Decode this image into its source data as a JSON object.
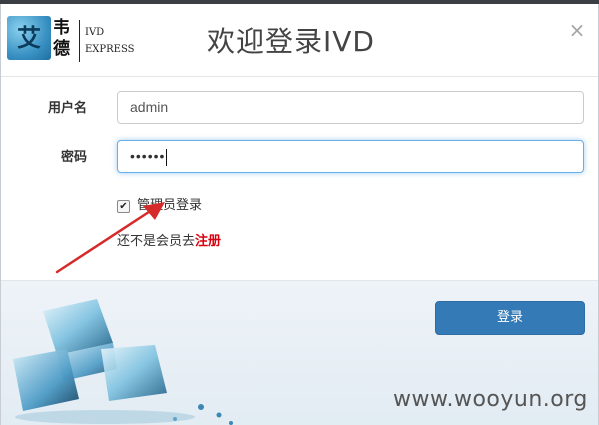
{
  "logo": {
    "badge_char": "艾",
    "chars_line1": "韦",
    "chars_line2": "德",
    "en_line1": "IVD",
    "en_line2": "EXPRESS"
  },
  "header": {
    "title": "欢迎登录IVD",
    "close_glyph": "×"
  },
  "form": {
    "username_label": "用户名",
    "username_value": "admin",
    "password_label": "密码",
    "password_value": "••••••",
    "admin_checkbox_label": "管理员登录",
    "admin_checked": true,
    "register_prefix": "还不是会员去",
    "register_link": "注册"
  },
  "login_button": "登录",
  "watermark": "www.wooyun.org",
  "colors": {
    "primary_button": "#337ab7",
    "register_link": "#d9000f",
    "arrow": "#d62a2a",
    "focus_border": "#66afe9"
  },
  "icons": {
    "close": "close-icon",
    "checkbox": "checkbox-icon"
  }
}
